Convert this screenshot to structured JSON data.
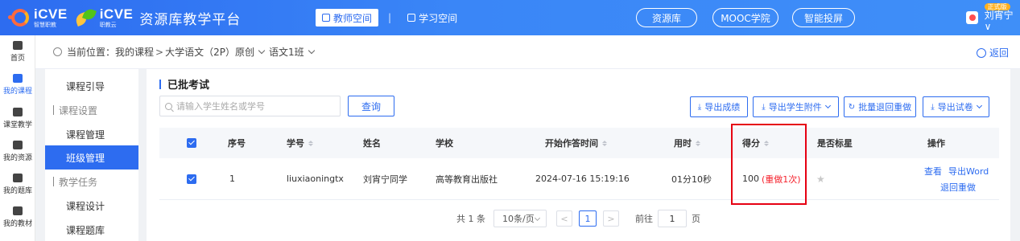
{
  "header": {
    "logo_icve": "iCVE",
    "logo_icve_sub": "智慧职教",
    "logo_icve2": "iCVE",
    "logo_icve2_sub": "职教云",
    "platform_title": "资源库教学平台",
    "tabs": [
      {
        "label": "教师空间",
        "active": true
      },
      {
        "label": "学习空间",
        "active": false
      }
    ],
    "tab_separator": "|",
    "pills": [
      "资源库",
      "MOOC学院",
      "智能投屏"
    ],
    "user_badge": "正式版",
    "user_name": "刘宵宁 ∨"
  },
  "rail": [
    {
      "label": "首页",
      "icon": "home-icon",
      "active": false
    },
    {
      "label": "我的课程",
      "icon": "course-icon",
      "active": true
    },
    {
      "label": "课堂教学",
      "icon": "classroom-icon",
      "active": false
    },
    {
      "label": "我的资源",
      "icon": "resource-icon",
      "active": false
    },
    {
      "label": "我的题库",
      "icon": "question-bank-icon",
      "active": false
    },
    {
      "label": "我的教材",
      "icon": "textbook-icon",
      "active": false
    }
  ],
  "breadcrumb": {
    "prefix": "当前位置：",
    "path": [
      "我的课程",
      "大学语文（2P）原创",
      "语文1班"
    ],
    "back": "返回"
  },
  "side_menu": {
    "items": [
      {
        "label": "课程引导",
        "type": "item"
      },
      {
        "label": "课程设置",
        "type": "group"
      },
      {
        "label": "课程管理",
        "type": "item"
      },
      {
        "label": "班级管理",
        "type": "item",
        "active": true
      },
      {
        "label": "教学任务",
        "type": "group"
      },
      {
        "label": "课程设计",
        "type": "item"
      },
      {
        "label": "课程题库",
        "type": "item"
      }
    ]
  },
  "main": {
    "title": "已批考试",
    "search_placeholder": "请输入学生姓名或学号",
    "query_label": "查询",
    "toolbar": [
      {
        "label": "导出成绩",
        "icon": "download-icon",
        "dropdown": false
      },
      {
        "label": "导出学生附件",
        "icon": "download-icon",
        "dropdown": true
      },
      {
        "label": "批量退回重做",
        "icon": "refresh-icon",
        "dropdown": false
      },
      {
        "label": "导出试卷",
        "icon": "download-icon",
        "dropdown": true
      }
    ],
    "table": {
      "columns": [
        "序号",
        "学号",
        "姓名",
        "学校",
        "开始作答时间",
        "用时",
        "得分",
        "是否标星",
        "操作"
      ],
      "rows": [
        {
          "checked": true,
          "index": "1",
          "student_id": "liuxiaoningtx",
          "name": "刘宵宁同学",
          "school": "高等教育出版社",
          "start_time": "2024-07-16 15:19:16",
          "duration": "01分10秒",
          "score": "100",
          "score_note": "(重做1次)",
          "starred": false,
          "actions": [
            "查看",
            "导出Word",
            "退回重做"
          ]
        }
      ]
    },
    "pagination": {
      "total": "共 1 条",
      "page_size": "10条/页",
      "prev": "<",
      "current_page": "1",
      "next": ">",
      "goto_label": "前往",
      "goto_value": "1",
      "page_suffix": "页"
    }
  },
  "colors": {
    "primary": "#2d6cf0",
    "highlight": "#e60012",
    "score_note": "#f5222d"
  }
}
